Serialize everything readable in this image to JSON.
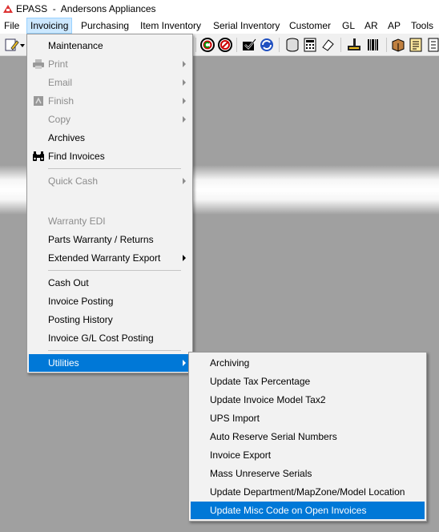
{
  "window": {
    "title": "EPASS  -  Andersons Appliances",
    "logo_icon": "epass-logo-icon"
  },
  "menubar": [
    {
      "label": "File"
    },
    {
      "label": "Invoicing"
    },
    {
      "label": "Purchasing"
    },
    {
      "label": "Item Inventory"
    },
    {
      "label": "Serial Inventory"
    },
    {
      "label": "Customer"
    },
    {
      "label": "GL"
    },
    {
      "label": "AR"
    },
    {
      "label": "AP"
    },
    {
      "label": "Tools"
    }
  ],
  "invoicing_menu": {
    "items": [
      {
        "label": "Maintenance",
        "enabled": true
      },
      {
        "label": "Print",
        "enabled": false,
        "submenu": true,
        "icon": "printer-icon"
      },
      {
        "label": "Email",
        "enabled": false,
        "submenu": true
      },
      {
        "label": "Finish",
        "enabled": false,
        "submenu": true,
        "icon": "finish-flag-icon"
      },
      {
        "label": "Copy",
        "enabled": false,
        "submenu": true
      },
      {
        "label": "Archives",
        "enabled": true
      },
      {
        "label": "Find Invoices",
        "enabled": true,
        "icon": "binoculars-icon"
      },
      {
        "label": "Quick Cash",
        "enabled": false,
        "submenu": true
      },
      {
        "label": "Warranty EDI",
        "enabled": false
      },
      {
        "label": "Parts Warranty / Returns",
        "enabled": true
      },
      {
        "label": "Extended Warranty Export",
        "enabled": true,
        "submenu": true
      },
      {
        "label": "Cash Out",
        "enabled": true
      },
      {
        "label": "Invoice Posting",
        "enabled": true
      },
      {
        "label": "Posting History",
        "enabled": true
      },
      {
        "label": "Invoice G/L Cost Posting",
        "enabled": true
      },
      {
        "label": "Utilities",
        "enabled": true,
        "submenu": true,
        "selected": true
      }
    ]
  },
  "utilities_submenu": {
    "items": [
      {
        "label": "Archiving"
      },
      {
        "label": "Update Tax Percentage"
      },
      {
        "label": "Update Invoice Model Tax2"
      },
      {
        "label": "UPS Import"
      },
      {
        "label": "Auto Reserve Serial Numbers"
      },
      {
        "label": "Invoice Export"
      },
      {
        "label": "Mass Unreserve Serials"
      },
      {
        "label": "Update Department/MapZone/Model Location"
      },
      {
        "label": "Update Misc Code on Open Invoices",
        "selected": true
      }
    ]
  },
  "colors": {
    "selection": "#0078d7",
    "workspace": "#a0a0a0",
    "menu_bg": "#f2f2f2",
    "disabled_text": "#8c8c8c"
  }
}
